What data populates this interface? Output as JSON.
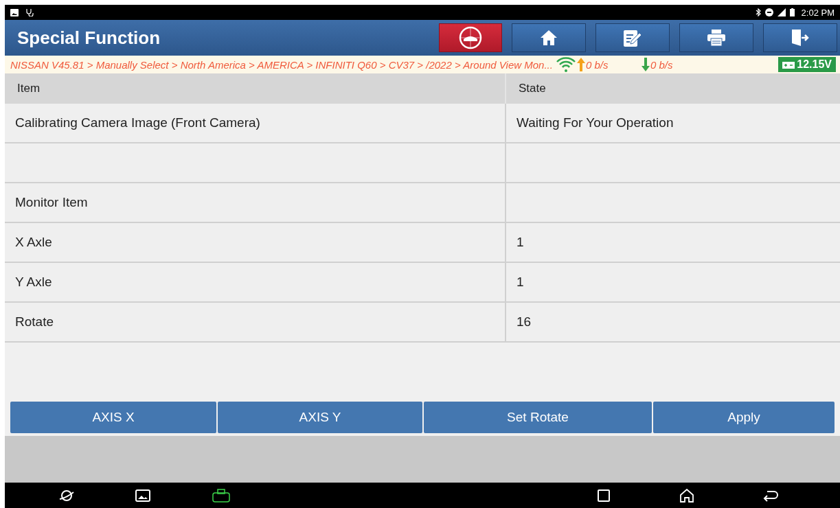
{
  "status_bar": {
    "time": "2:02 PM"
  },
  "header": {
    "title": "Special Function"
  },
  "breadcrumb": {
    "path": "NISSAN V45.81 > Manually Select > North America > AMERICA > INFINITI Q60 > CV37 > /2022 > Around View Mon...",
    "upload": "0 b/s",
    "download": "0 b/s",
    "voltage": "12.15V"
  },
  "table": {
    "columns": [
      "Item",
      "State"
    ],
    "rows": [
      {
        "item": "Calibrating Camera Image (Front Camera)",
        "state": "Waiting For Your Operation"
      },
      {
        "item": "",
        "state": ""
      },
      {
        "item": "Monitor Item",
        "state": ""
      },
      {
        "item": "X Axle",
        "state": "1"
      },
      {
        "item": "Y Axle",
        "state": "1"
      },
      {
        "item": "Rotate",
        "state": "16"
      }
    ]
  },
  "buttons": [
    "AXIS X",
    "AXIS Y",
    "Set Rotate",
    "Apply"
  ]
}
